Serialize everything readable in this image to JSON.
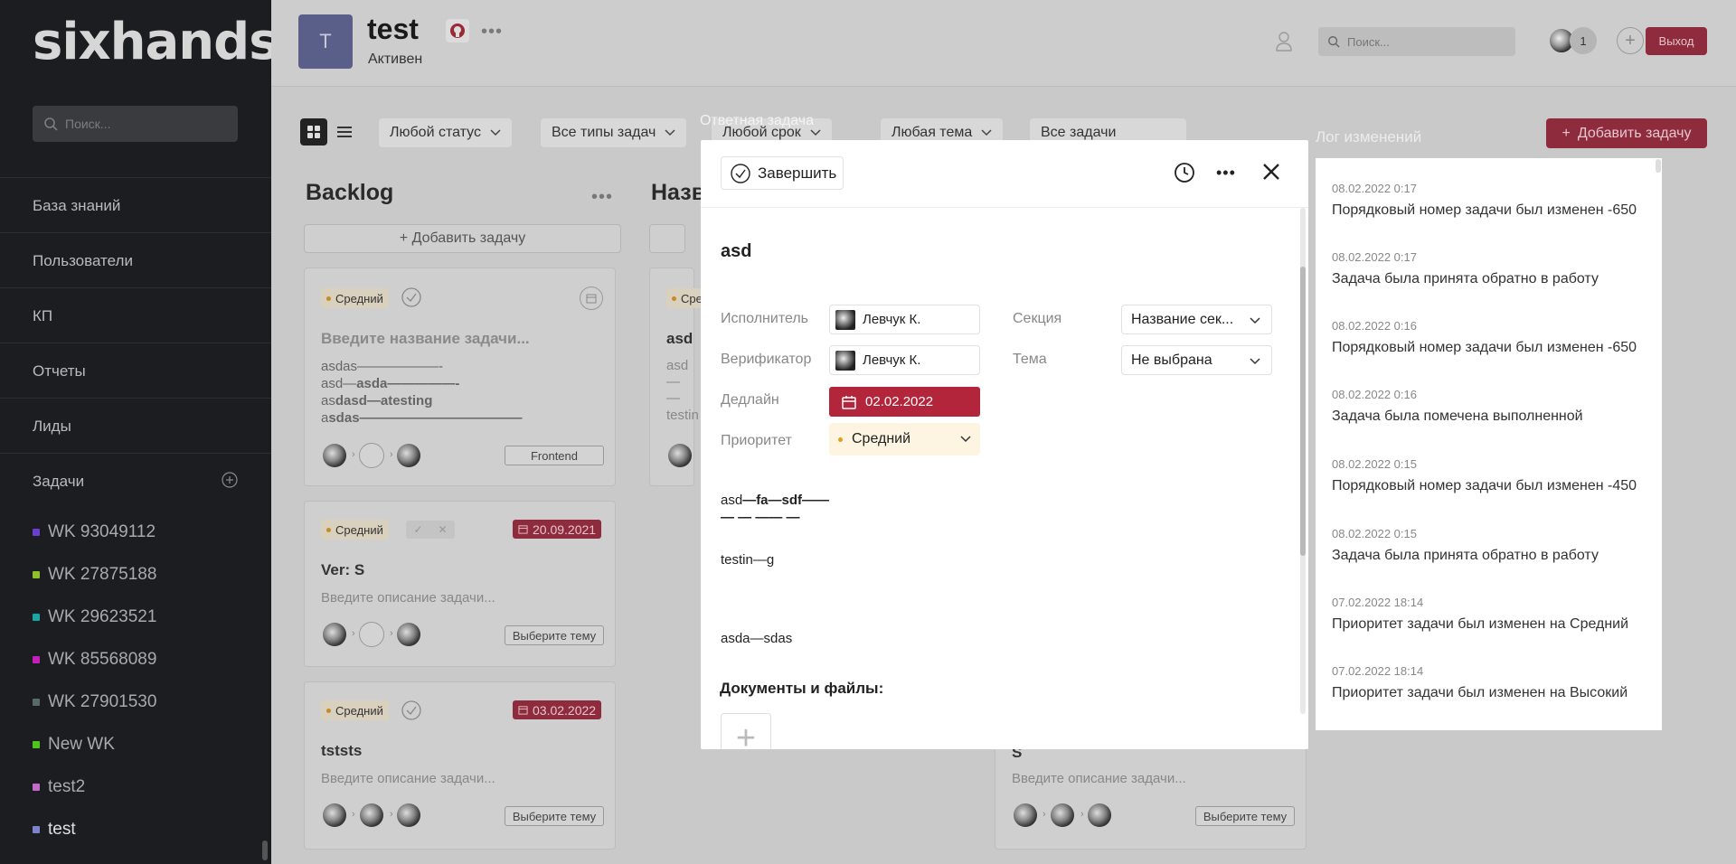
{
  "sidebar": {
    "logo": "sixhands",
    "search_placeholder": "Поиск...",
    "nav": [
      "База знаний",
      "Пользователи",
      "КП",
      "Отчеты",
      "Лиды",
      "Задачи"
    ],
    "projects": [
      {
        "name": "WK 93049112",
        "color": "#6a3fd0"
      },
      {
        "name": "WK 27875188",
        "color": "#8fbf2a"
      },
      {
        "name": "WK 29623521",
        "color": "#1aa5a5"
      },
      {
        "name": "WK 85568089",
        "color": "#c51fb9"
      },
      {
        "name": "WK 27901530",
        "color": "#5a6a6a"
      },
      {
        "name": "New WK",
        "color": "#4fc21f"
      },
      {
        "name": "test2",
        "color": "#c46ac9"
      },
      {
        "name": "test",
        "color": "#7d82c9"
      }
    ]
  },
  "header": {
    "avatar_letter": "T",
    "title": "test",
    "status": "Активен",
    "search_placeholder": "Поиск...",
    "members_count": "1",
    "logout": "Выход"
  },
  "filters": [
    "Любой статус",
    "Все типы задач",
    "Любой срок",
    "Любая тема",
    "Все задачи"
  ],
  "add_task_label": "Добавить задачу",
  "columns": [
    {
      "title": "Backlog",
      "add_label": "+ Добавить задачу"
    },
    {
      "title": "Назв",
      "add_label": ""
    }
  ],
  "cards": [
    {
      "priority": "Средний",
      "title": "Введите название задачи...",
      "desc_lines": [
        "asdas——————-",
        "asd—",
        "asda—————-",
        "as",
        "dasd—atesting",
        "a",
        "sdas————————————"
      ],
      "tag": "Frontend"
    },
    {
      "priority": "Средний",
      "date": "20.09.2021",
      "title": "Ver: S",
      "desc": "Введите описание задачи...",
      "tag": "Выберите тему"
    },
    {
      "priority": "Средний",
      "date": "03.02.2022",
      "title": "tststs",
      "desc": "Введите описание задачи...",
      "tag": "Выберите тему"
    },
    {
      "priority": "Сре",
      "title": "asd",
      "desc_a": "asd",
      "desc_b": "— —",
      "desc_c": "testin"
    },
    {
      "title": "S",
      "desc": "Введите описание задачи...",
      "tag": "Выберите тему"
    }
  ],
  "modal": {
    "label": "Ответная задача",
    "finish": "Завершить",
    "title": "asd",
    "fields": {
      "executor_label": "Исполнитель",
      "executor": "Левчук К.",
      "verifier_label": "Верификатор",
      "verifier": "Левчук К.",
      "deadline_label": "Дедлайн",
      "deadline": "02.02.2022",
      "priority_label": "Приоритет",
      "priority": "Средний",
      "section_label": "Секция",
      "section": "Название сек...",
      "theme_label": "Тема",
      "theme": "Не выбрана"
    },
    "description": {
      "line1a": "asd",
      "line1b": "—fa—sdf——",
      "line2": "— — —— —",
      "line3": "testin—g",
      "line4": "asda—sdas"
    },
    "docs_title": "Документы и файлы:"
  },
  "log": {
    "title": "Лог изменений",
    "entries": [
      {
        "date": "08.02.2022 0:17",
        "text": "Порядковый номер задачи был изменен -650"
      },
      {
        "date": "08.02.2022 0:17",
        "text": "Задача была принята обратно в работу"
      },
      {
        "date": "08.02.2022 0:16",
        "text": "Порядковый номер задачи был изменен -650"
      },
      {
        "date": "08.02.2022 0:16",
        "text": "Задача была помечена выполненной"
      },
      {
        "date": "08.02.2022 0:15",
        "text": "Порядковый номер задачи был изменен -450"
      },
      {
        "date": "08.02.2022 0:15",
        "text": "Задача была принята обратно в работу"
      },
      {
        "date": "07.02.2022 18:14",
        "text": "Приоритет задачи был изменен на Средний"
      },
      {
        "date": "07.02.2022 18:14",
        "text": "Приоритет задачи был изменен на Высокий"
      }
    ]
  },
  "colors": {
    "accent": "#8e2b3d",
    "deadline": "#b3253a",
    "sidebar": "#1c1d20"
  },
  "icons": [
    "search-icon",
    "github-icon",
    "more-icon",
    "user-icon",
    "plus-icon",
    "grid-view-icon",
    "list-view-icon",
    "chevron-down-icon",
    "check-circle-icon",
    "history-icon",
    "close-icon",
    "calendar-icon"
  ]
}
